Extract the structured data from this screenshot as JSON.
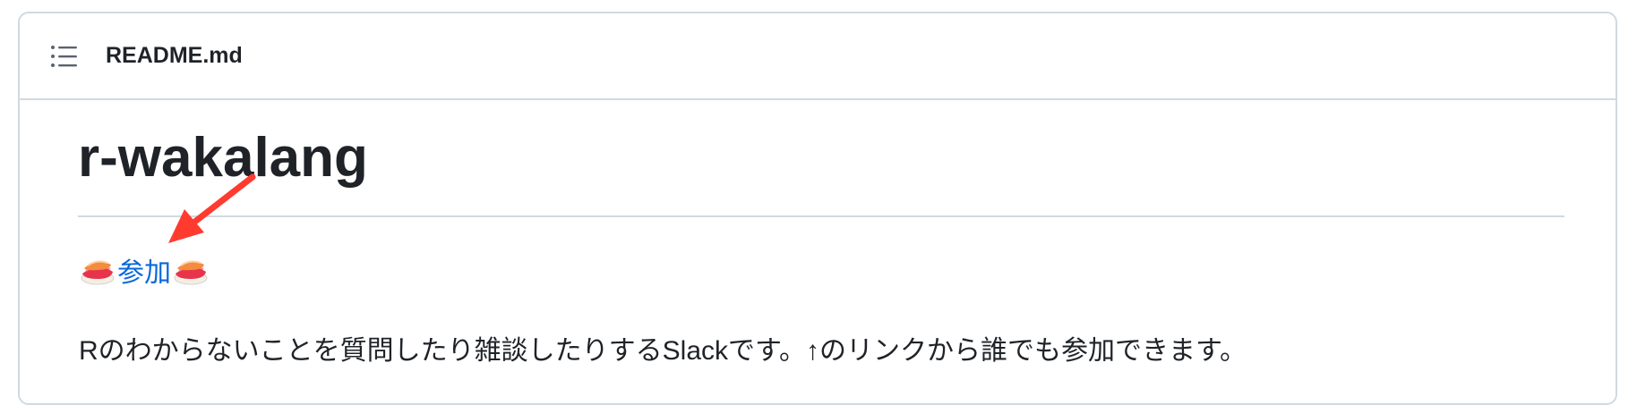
{
  "header": {
    "toc_icon": "list-unordered-icon",
    "file_name": "README.md"
  },
  "readme": {
    "title": "r-wakalang",
    "join_prefix_emoji": "sushi-icon",
    "join_link_label": "参加",
    "join_suffix_emoji": "sushi-icon",
    "description": "Rのわからないことを質問したり雑談したりするSlackです。↑のリンクから誰でも参加できます。"
  },
  "annotation": {
    "arrow_color": "#ff3b30",
    "arrow_icon": "red-arrow-icon"
  },
  "colors": {
    "link": "#0969da",
    "border": "#d1d9e0",
    "text": "#1f2328"
  }
}
